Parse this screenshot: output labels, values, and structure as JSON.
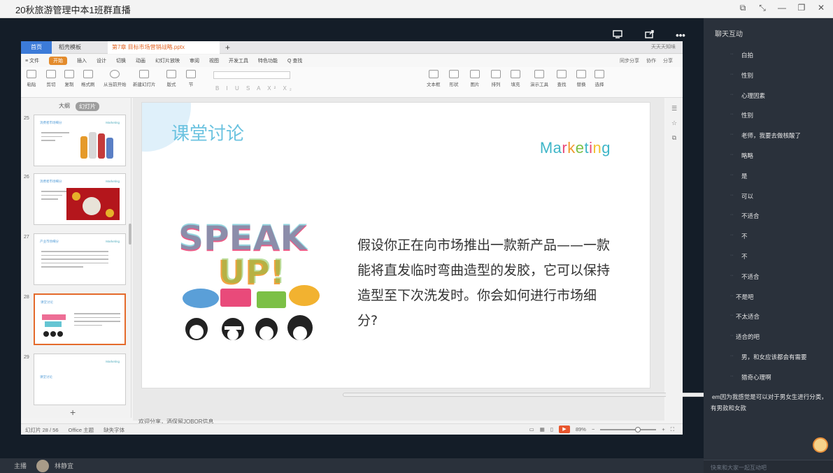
{
  "window": {
    "title": "20秋旅游管理中本1班群直播",
    "buttons": [
      "⧉",
      "⤡",
      "—",
      "❐",
      "✕"
    ]
  },
  "overlay": {
    "icons": [
      "screen-share-icon",
      "share-icon",
      "more-icon"
    ],
    "more_label": "•••"
  },
  "wps": {
    "tabs": {
      "home": "首页",
      "template": "稻壳模板",
      "file": "第7章 目标市场营销战略.pptx",
      "plus": "+"
    },
    "user": "天天天知味",
    "menu": [
      "≡ 文件",
      "开始",
      "插入",
      "设计",
      "切换",
      "动画",
      "幻灯片放映",
      "审阅",
      "视图",
      "开发工具",
      "特色功能",
      "Q 查找"
    ],
    "menu_active": "开始",
    "menu_right": [
      "同步分享",
      "协作",
      "分享"
    ],
    "toolbar": {
      "paste": "粘贴",
      "cut": "剪切",
      "copy": "复制",
      "format": "格式刷",
      "play": "从当前开始",
      "newslide": "新建幻灯片",
      "layout": "版式",
      "section": "节",
      "reset": "重置",
      "textbox": "文本框",
      "shape": "形状",
      "picture": "图片",
      "arrange": "排列",
      "fill": "填充",
      "present": "演示工具",
      "find": "查找",
      "replace": "替换",
      "select": "选择",
      "format_row": "B I U S A X² X₂"
    },
    "panel": {
      "outline": "大纲",
      "slides": "幻灯片"
    },
    "thumbs": [
      {
        "num": "25",
        "title": "消费者市场细分",
        "mark": "Marketing"
      },
      {
        "num": "26",
        "title": "消费者市场细分",
        "mark": "Marketing"
      },
      {
        "num": "27",
        "title": "产业市场细分",
        "mark": "Marketing"
      },
      {
        "num": "28",
        "title": "课堂讨论",
        "mark": ""
      },
      {
        "num": "29",
        "title": "课堂讨论",
        "mark": "Marketing"
      }
    ],
    "add_slide": "+",
    "notes": "欢迎分享，酒保留JOBOR信息",
    "status": {
      "slide_count": "幻灯片 28 / 56",
      "theme": "Office 主题",
      "font": "缺失字体",
      "zoom": "89%",
      "zoom_minus": "−",
      "zoom_plus": "+",
      "play": "▶"
    }
  },
  "slide": {
    "heading": "课堂讨论",
    "brand_letters": [
      {
        "ch": "M",
        "color": "#3fb6c8"
      },
      {
        "ch": "a",
        "color": "#3fb6c8"
      },
      {
        "ch": "r",
        "color": "#e94a7a"
      },
      {
        "ch": "k",
        "color": "#f29a2e"
      },
      {
        "ch": "e",
        "color": "#7cc046"
      },
      {
        "ch": "t",
        "color": "#3fb6c8"
      },
      {
        "ch": "i",
        "color": "#e94a7a"
      },
      {
        "ch": "n",
        "color": "#f2c230"
      },
      {
        "ch": "g",
        "color": "#3fb6c8"
      }
    ],
    "speak_line1": "SPEAK",
    "speak_line2": "UP!",
    "question": "假设你正在向市场推出一款新产品——一款能将直发临时弯曲造型的发胶，它可以保持造型至下次洗发时。你会如何进行市场细分?"
  },
  "bottom": {
    "host_label": "主播",
    "host_name": "林静宜"
  },
  "chat": {
    "title": "聊天互动",
    "messages": [
      "白拍",
      "性别",
      "心理因素",
      "性别",
      "老师，我要去做核酸了",
      "略略",
      "是",
      "可以",
      "不适合",
      "不",
      "不",
      "不适合",
      "不是吧",
      "不太适合",
      "适合的吧",
      "男，和女应该都会有需要",
      "猎奇心理啊"
    ],
    "last_message": "em因为我感觉是可以对于男女生进行分类，有男款和女款",
    "input_placeholder": "快来和大家一起互动吧"
  }
}
